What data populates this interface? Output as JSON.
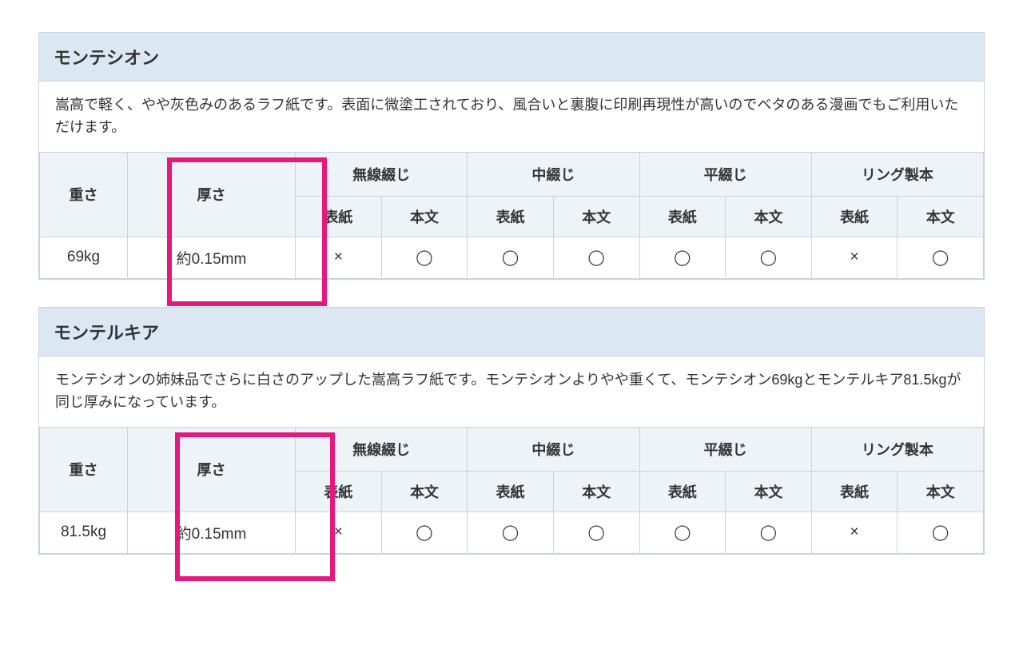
{
  "common": {
    "weight_header": "重さ",
    "thickness_header": "厚さ",
    "binding_groups": [
      "無線綴じ",
      "中綴じ",
      "平綴じ",
      "リング製本"
    ],
    "sub_headers": [
      "表紙",
      "本文"
    ],
    "mark_yes": "◯",
    "mark_no": "×"
  },
  "panels": [
    {
      "title": "モンテシオン",
      "description": "嵩高で軽く、やや灰色みのあるラフ紙です。表面に微塗工されており、風合いと裏腹に印刷再現性が高いのでベタのある漫画でもご利用いただけます。",
      "row": {
        "weight": "69kg",
        "thickness": "約0.15mm",
        "cells": [
          "no",
          "yes",
          "yes",
          "yes",
          "yes",
          "yes",
          "no",
          "yes"
        ]
      }
    },
    {
      "title": "モンテルキア",
      "description": "モンテシオンの姉妹品でさらに白さのアップした嵩高ラフ紙です。モンテシオンよりやや重くて、モンテシオン69kgとモンテルキア81.5kgが同じ厚みになっています。",
      "row": {
        "weight": "81.5kg",
        "thickness": "約0.15mm",
        "cells": [
          "no",
          "yes",
          "yes",
          "yes",
          "yes",
          "yes",
          "no",
          "yes"
        ]
      }
    }
  ]
}
